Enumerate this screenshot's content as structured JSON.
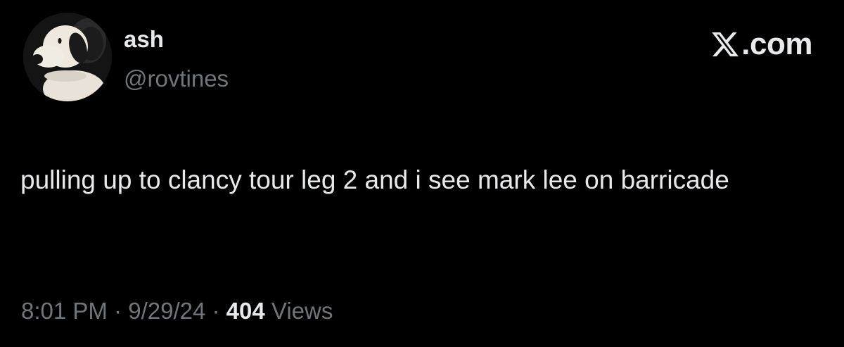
{
  "author": {
    "display_name": "ash",
    "handle": "@rovtines"
  },
  "brand": {
    "label": ".com",
    "icon": "x-logo-icon"
  },
  "tweet": {
    "text": "pulling up to clancy tour leg 2 and i see mark lee on barricade"
  },
  "meta": {
    "time": "8:01 PM",
    "separator": " · ",
    "date": "9/29/24",
    "views_count": "404",
    "views_label": "Views"
  },
  "colors": {
    "background": "#000000",
    "primary_text": "#e7e9ea",
    "secondary_text": "#71767b"
  }
}
